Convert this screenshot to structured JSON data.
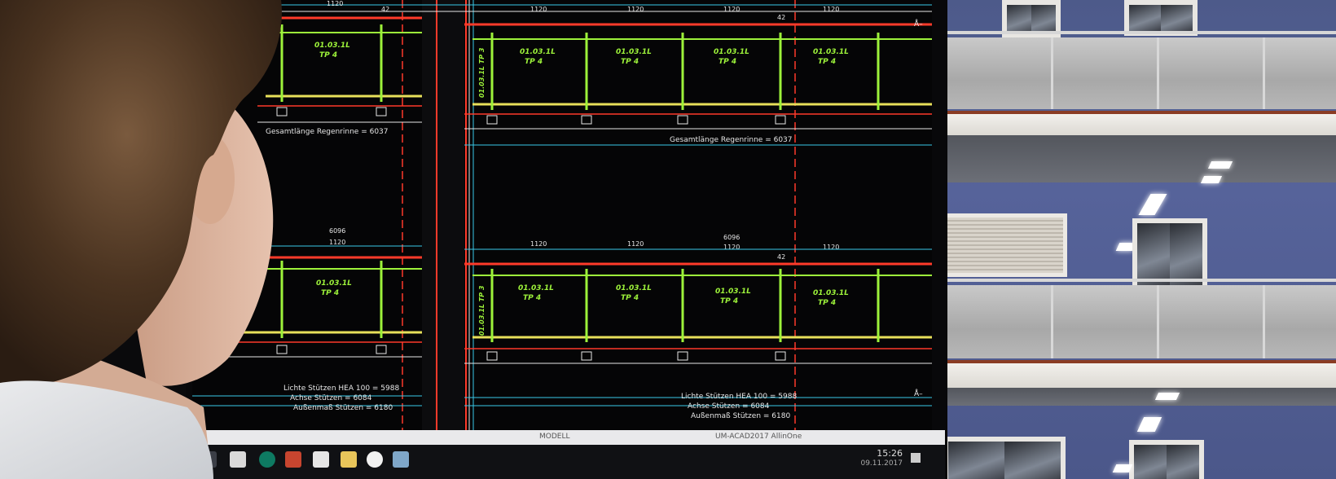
{
  "cad": {
    "panel_label_code": "01.03.1L",
    "panel_label_type": "TP 4",
    "side_label": "01.03.1L TP 3",
    "gutter_length": "Gesamtlänge Regenrinne = 6037",
    "dimension_total": "6096",
    "dimension_seg": "1120",
    "dimension_small": "42",
    "clear_columns": "Lichte Stützen HEA 100 = 5988",
    "axis_columns": "Achse Stützen = 6084",
    "outer_columns": "Außenmaß Stützen = 6180",
    "cursor_mark": "Å–"
  },
  "statusbar": {
    "mode": "MODELL",
    "workspace": "UM-ACAD2017 AllinOne"
  },
  "taskbar": {
    "time": "15:26",
    "date": "09.11.2017",
    "icons": [
      "start-icon",
      "file-explorer-icon",
      "g-app-icon",
      "autocad-icon",
      "s-app-icon",
      "folder-icon",
      "browser-icon",
      "monitor-icon"
    ]
  },
  "colors": {
    "cad_green": "#9df23a",
    "cad_red": "#ff3a2a",
    "cad_cyan": "#39c9e8",
    "cad_white": "#e6e6e6",
    "facade_blue": "#505d92"
  }
}
